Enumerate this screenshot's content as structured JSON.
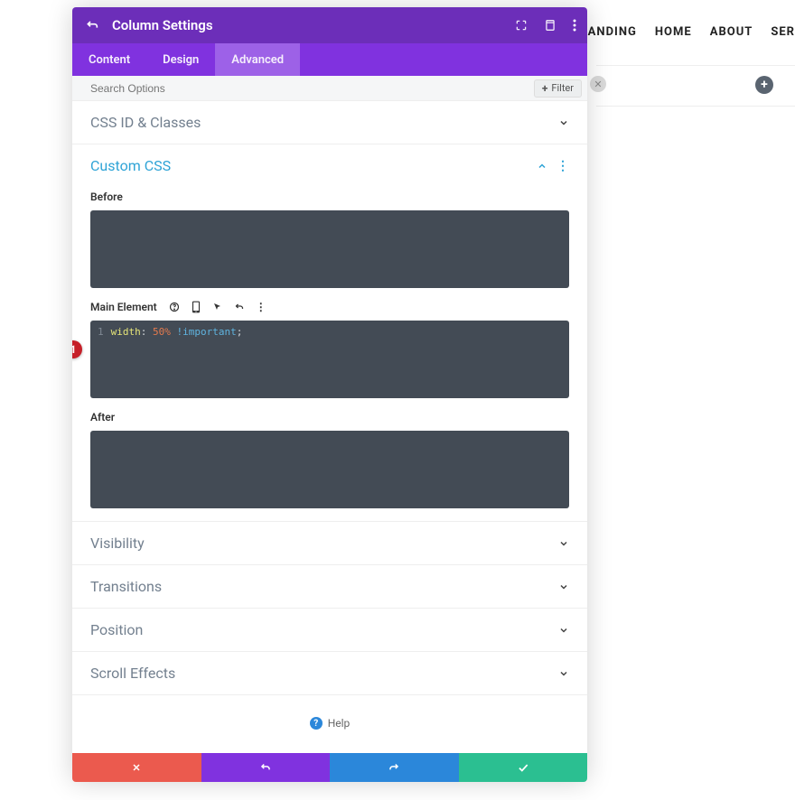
{
  "nav": {
    "items": [
      "LANDING",
      "HOME",
      "ABOUT",
      "SER"
    ]
  },
  "panel": {
    "title": "Column Settings",
    "tabs": {
      "content": "Content",
      "design": "Design",
      "advanced": "Advanced"
    },
    "search_placeholder": "Search Options",
    "filter_label": "Filter"
  },
  "sections": {
    "cssid": "CSS ID & Classes",
    "customcss": "Custom CSS",
    "visibility": "Visibility",
    "transitions": "Transitions",
    "position": "Position",
    "scrolleffects": "Scroll Effects"
  },
  "customcss": {
    "before_label": "Before",
    "main_label": "Main Element",
    "after_label": "After",
    "code_line_no": "1",
    "code_prop": "width",
    "code_colon": ":",
    "code_value": "50",
    "code_unit": "%",
    "code_important": "!important",
    "code_semi": ";"
  },
  "help": {
    "label": "Help"
  },
  "marker": {
    "num": "1"
  }
}
